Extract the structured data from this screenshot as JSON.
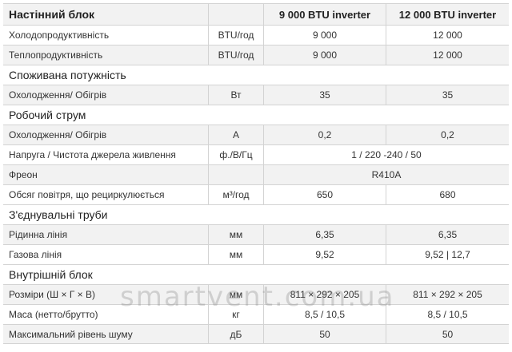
{
  "header": {
    "title": "Настінний блок",
    "unit": "",
    "col1": "9 000 BTU  inverter",
    "col2": "12 000 BTU  inverter"
  },
  "rows_a": [
    {
      "name": "Холодопродуктивність",
      "unit": "BTU/год",
      "v1": "9 000",
      "v2": "12 000"
    },
    {
      "name": "Теплопродуктивність",
      "unit": "BTU/год",
      "v1": "9 000",
      "v2": "12 000"
    }
  ],
  "section_power": "Споживана потужність",
  "rows_b": [
    {
      "name": "Охолодження/ Обігрів",
      "unit": "Вт",
      "v1": "35",
      "v2": "35"
    }
  ],
  "section_current": "Робочий струм",
  "rows_c": [
    {
      "name": "Охолодження/ Обігрів",
      "unit": "А",
      "v1": "0,2",
      "v2": "0,2"
    },
    {
      "name": "Напруга / Чистота джерела живлення",
      "unit": "ф./В/Гц",
      "span": "1 / 220 -240 / 50"
    },
    {
      "name": "Фреон",
      "unit": "",
      "span": "R410A"
    },
    {
      "name": "Обсяг повітря, що рециркулюється",
      "unit": "м³/год",
      "v1": "650",
      "v2": "680"
    }
  ],
  "section_pipes": "З'єднувальні труби",
  "rows_d": [
    {
      "name": "Рідинна лінія",
      "unit": "мм",
      "v1": "6,35",
      "v2": "6,35"
    },
    {
      "name": "Газова лінія",
      "unit": "мм",
      "v1": "9,52",
      "v2": "9,52 | 12,7"
    }
  ],
  "section_indoor": "Внутрішній блок",
  "rows_e": [
    {
      "name": "Розміри (Ш × Г × В)",
      "unit": "мм",
      "v1": "811 × 292 × 205",
      "v2": "811 × 292 × 205"
    },
    {
      "name": "Маса (нетто/брутто)",
      "unit": "кг",
      "v1": "8,5 / 10,5",
      "v2": "8,5 / 10,5"
    },
    {
      "name": "Максимальний рівень шуму",
      "unit": "дБ",
      "v1": "50",
      "v2": "50"
    }
  ],
  "watermark": "smartvent.com.ua"
}
